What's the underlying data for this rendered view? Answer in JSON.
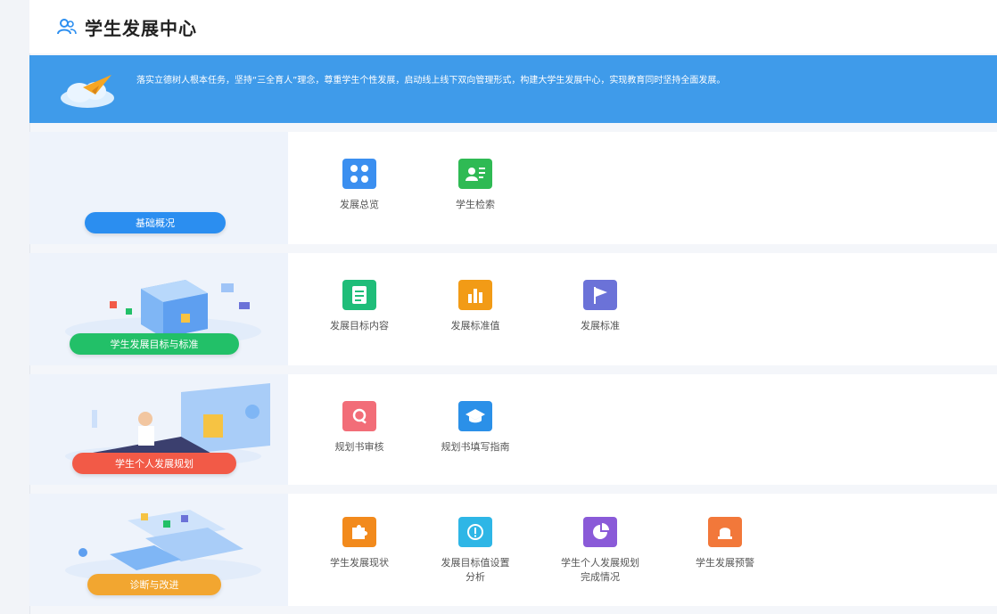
{
  "header": {
    "title": "学生发展中心",
    "icon": "user-group-icon"
  },
  "banner": {
    "text": "落实立德树人根本任务，坚持“三全育人”理念，尊重学生个性发展，启动线上线下双向管理形式，构建大学生发展中心，实现教育同时坚持全面发展。"
  },
  "sections": [
    {
      "label": "基础概况",
      "color": "#2b8ef0",
      "items": [
        {
          "label": "发展总览",
          "color": "#3b8ff0",
          "icon": "grid-icon"
        },
        {
          "label": "学生检索",
          "color": "#2fba54",
          "icon": "contact-card-icon"
        }
      ]
    },
    {
      "label": "学生发展目标与标准",
      "color": "#22c068",
      "items": [
        {
          "label": "发展目标内容",
          "color": "#1fbd79",
          "icon": "document-icon"
        },
        {
          "label": "发展标准值",
          "color": "#f29b16",
          "icon": "bar-chart-icon"
        },
        {
          "label": "发展标准",
          "color": "#6b72d8",
          "icon": "flag-icon"
        }
      ]
    },
    {
      "label": "学生个人发展规划",
      "color": "#f25a47",
      "items": [
        {
          "label": "规划书审核",
          "color": "#f26d78",
          "icon": "search-icon"
        },
        {
          "label": "规划书填写指南",
          "color": "#2b90e8",
          "icon": "graduation-cap-icon"
        }
      ]
    },
    {
      "label": "诊断与改进",
      "color": "#f2a630",
      "items": [
        {
          "label": "学生发展现状",
          "color": "#f28a1c",
          "icon": "puzzle-icon"
        },
        {
          "label": "发展目标值设置分析",
          "color": "#2eb6e6",
          "icon": "alert-circle-icon"
        },
        {
          "label": "学生个人发展规划完成情况",
          "color": "#8a5ad8",
          "icon": "pie-chart-icon"
        },
        {
          "label": "学生发展预警",
          "color": "#f2783a",
          "icon": "bell-icon"
        }
      ]
    }
  ]
}
